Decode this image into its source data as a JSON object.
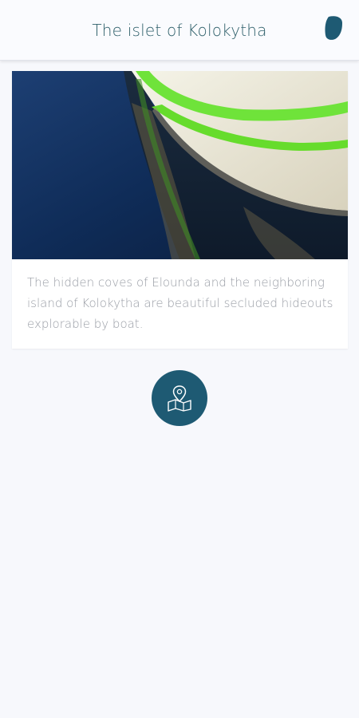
{
  "header": {
    "title": "The islet of Kolokytha",
    "logo_icon": "leaf-logo-icon"
  },
  "card": {
    "image_subject": "boat-hull-reflection",
    "description": "The hidden coves of Elounda and the neighboring island of Kolokytha are beautiful secluded hideouts explorable by boat."
  },
  "map_button": {
    "icon": "map-pin-icon"
  },
  "colors": {
    "background": "#f7f8fc",
    "accent": "#1e5a73",
    "title_text": "#2e5f6a",
    "body_text": "#9a9ea6"
  }
}
